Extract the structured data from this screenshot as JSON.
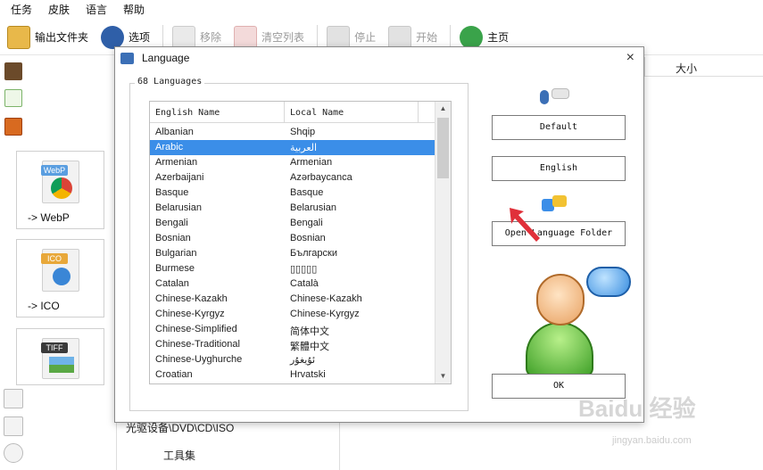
{
  "menu": [
    "任务",
    "皮肤",
    "语言",
    "帮助"
  ],
  "toolbar": {
    "output_folder": "输出文件夹",
    "options": "选项",
    "remove": "移除",
    "clear_list": "清空列表",
    "stop": "停止",
    "start": "开始",
    "home": "主页"
  },
  "tiles": [
    {
      "label": "-> WebP",
      "badge": "WebP"
    },
    {
      "label": "-> ICO",
      "badge": "ICO"
    },
    {
      "label": "",
      "badge": "TIFF"
    }
  ],
  "bottom": {
    "optical": "光驱设备\\DVD\\CD\\ISO",
    "tools": "工具集"
  },
  "bg_header": {
    "size": "大小"
  },
  "dialog": {
    "title": "Language",
    "close": "×",
    "group_label": "68 Languages",
    "col_english": "English Name",
    "col_local": "Local Name",
    "selected_index": 1,
    "rows": [
      {
        "en": "Albanian",
        "local": "Shqip"
      },
      {
        "en": "Arabic",
        "local": "العربية"
      },
      {
        "en": "Armenian",
        "local": "Armenian"
      },
      {
        "en": "Azerbaijani",
        "local": "Azərbaycanca"
      },
      {
        "en": "Basque",
        "local": "Basque"
      },
      {
        "en": "Belarusian",
        "local": "Belarusian"
      },
      {
        "en": "Bengali",
        "local": "Bengali"
      },
      {
        "en": "Bosnian",
        "local": "Bosnian"
      },
      {
        "en": "Bulgarian",
        "local": "Български"
      },
      {
        "en": "Burmese",
        "local": "▯▯▯▯▯"
      },
      {
        "en": "Catalan",
        "local": "Català"
      },
      {
        "en": "Chinese-Kazakh",
        "local": "Chinese-Kazakh"
      },
      {
        "en": "Chinese-Kyrgyz",
        "local": "Chinese-Kyrgyz"
      },
      {
        "en": "Chinese-Simplified",
        "local": "简体中文"
      },
      {
        "en": "Chinese-Traditional",
        "local": "繁體中文"
      },
      {
        "en": "Chinese-Uyghurche",
        "local": "ئۇيغۇر"
      },
      {
        "en": "Croatian",
        "local": "Hrvatski"
      }
    ],
    "buttons": {
      "default": "Default",
      "english": "English",
      "open_folder": "Open Language Folder",
      "ok": "OK"
    }
  },
  "watermark": {
    "main": "Baidu 经验",
    "sub": "jingyan.baidu.com"
  },
  "colors": {
    "selection": "#3b8ee8",
    "title_icon": "#3b6fb6",
    "arrow": "#e0303a"
  }
}
